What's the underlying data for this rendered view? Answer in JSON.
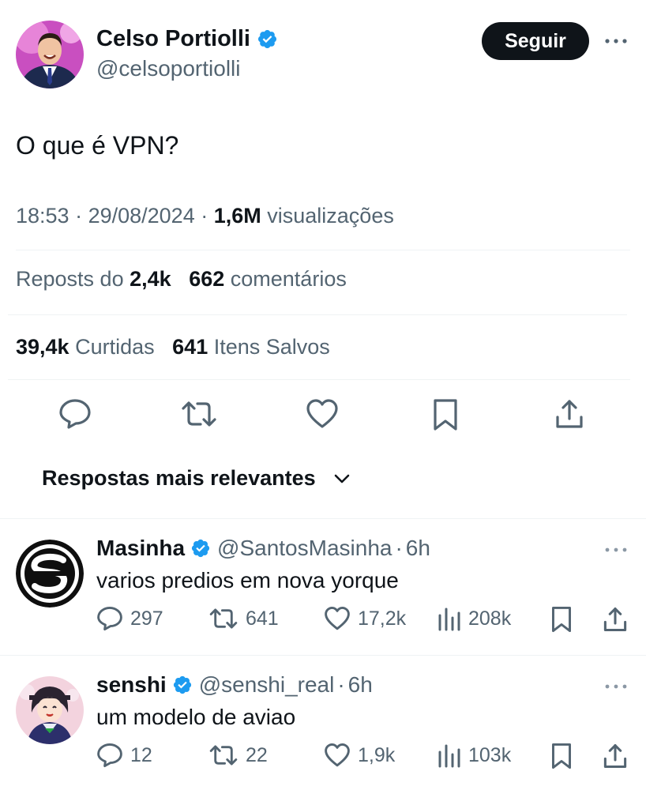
{
  "tweet": {
    "author_name": "Celso Portiolli",
    "author_handle": "@celsoportiolli",
    "follow_label": "Seguir",
    "text": "O que é VPN?",
    "time": "18:53",
    "date": "29/08/2024",
    "views_count": "1,6M",
    "views_label": "visualizações",
    "reposts_label": "Reposts do",
    "reposts_count": "2,4k",
    "comments_count": "662",
    "comments_label": "comentários",
    "likes_count": "39,4k",
    "likes_label": "Curtidas",
    "saves_count": "641",
    "saves_label": "Itens Salvos"
  },
  "sort": {
    "label": "Respostas mais relevantes"
  },
  "replies": [
    {
      "name": "Masinha",
      "handle": "@SantosMasinha",
      "time": "6h",
      "text": "varios predios em nova yorque",
      "comments": "297",
      "reposts": "641",
      "likes": "17,2k",
      "views": "208k"
    },
    {
      "name": "senshi",
      "handle": "@senshi_real",
      "time": "6h",
      "text": "um modelo de aviao",
      "comments": "12",
      "reposts": "22",
      "likes": "1,9k",
      "views": "103k"
    }
  ],
  "colors": {
    "text_primary": "#0f1419",
    "text_secondary": "#536471",
    "verified_blue": "#1d9bf0",
    "divider": "#eff3f4",
    "button_dark": "#0f1419"
  },
  "icons": [
    "verified-badge-icon",
    "more-icon",
    "reply-icon",
    "repost-icon",
    "like-icon",
    "bookmark-icon",
    "share-icon",
    "views-icon",
    "chevron-down-icon"
  ]
}
